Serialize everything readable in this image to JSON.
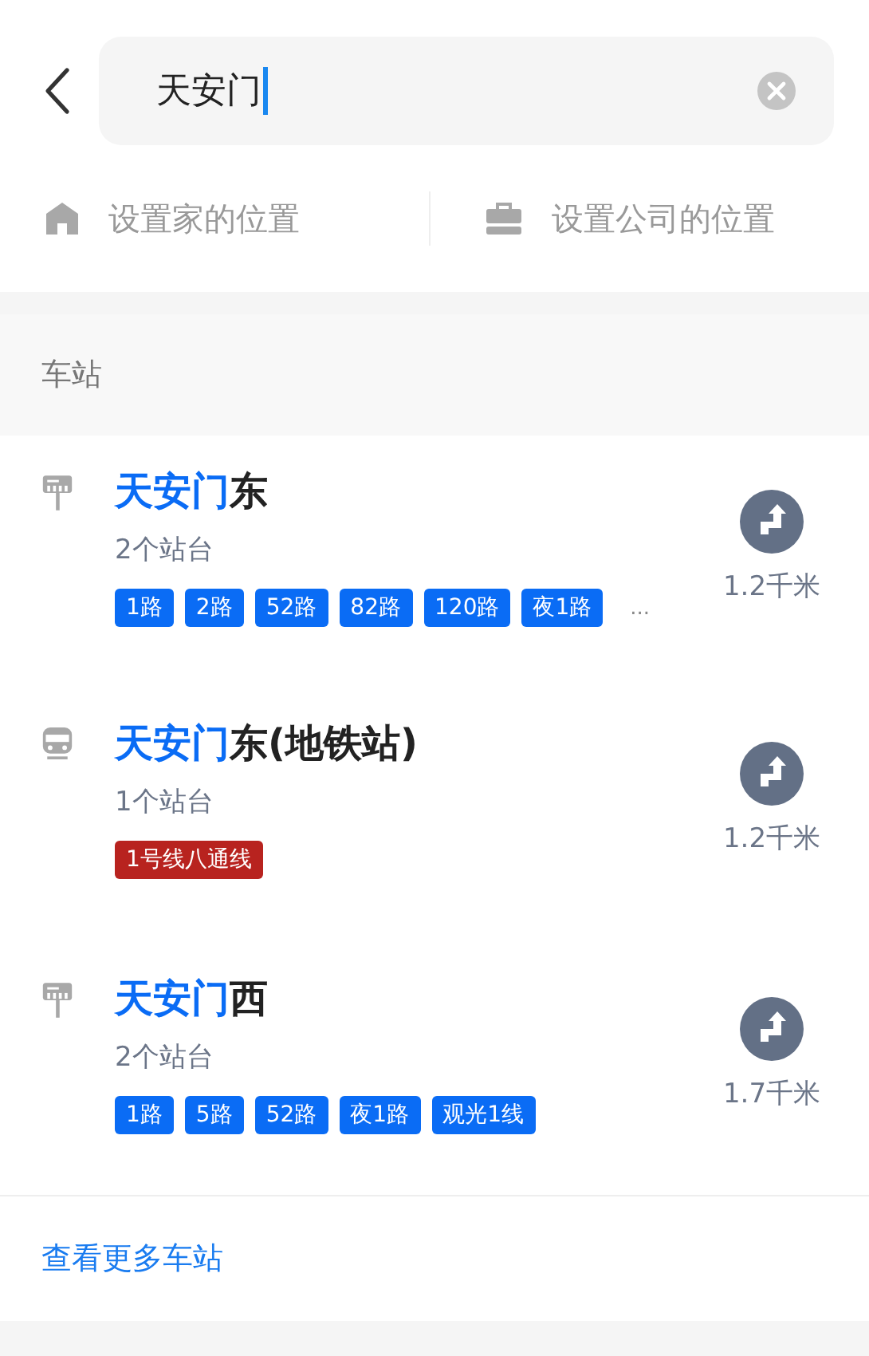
{
  "search": {
    "value": "天安门",
    "focused": true
  },
  "shortcuts": [
    {
      "kind": "home",
      "label": "设置家的位置"
    },
    {
      "kind": "company",
      "label": "设置公司的位置"
    }
  ],
  "section": {
    "title": "车站"
  },
  "stations": [
    {
      "kind": "bus",
      "match": "天安门",
      "rest": "东",
      "platforms": "2个站台",
      "distance": "1.2千米",
      "more": "...",
      "lines": [
        {
          "label": "1路",
          "color": "#0a6cf5"
        },
        {
          "label": "2路",
          "color": "#0a6cf5"
        },
        {
          "label": "52路",
          "color": "#0a6cf5"
        },
        {
          "label": "82路",
          "color": "#0a6cf5"
        },
        {
          "label": "120路",
          "color": "#0a6cf5"
        },
        {
          "label": "夜1路",
          "color": "#0a6cf5"
        }
      ]
    },
    {
      "kind": "subway",
      "match": "天安门",
      "rest": "东(地铁站)",
      "platforms": "1个站台",
      "distance": "1.2千米",
      "lines": [
        {
          "label": "1号线八通线",
          "color": "#b8231f"
        }
      ]
    },
    {
      "kind": "bus",
      "match": "天安门",
      "rest": "西",
      "platforms": "2个站台",
      "distance": "1.7千米",
      "lines": [
        {
          "label": "1路",
          "color": "#0a6cf5"
        },
        {
          "label": "5路",
          "color": "#0a6cf5"
        },
        {
          "label": "52路",
          "color": "#0a6cf5"
        },
        {
          "label": "夜1路",
          "color": "#0a6cf5"
        },
        {
          "label": "观光1线",
          "color": "#0a6cf5"
        }
      ]
    }
  ],
  "more_link": "查看更多车站"
}
